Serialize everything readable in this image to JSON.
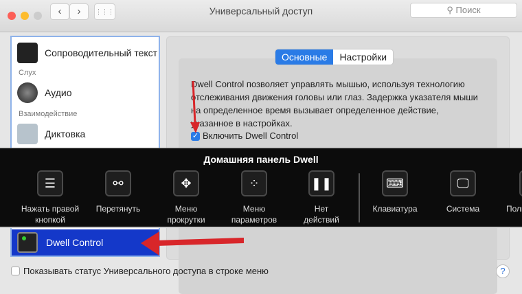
{
  "window": {
    "title": "Универсальный доступ",
    "search_placeholder": "Поиск",
    "back": "‹",
    "forward": "›",
    "grid": "⋮⋮⋮"
  },
  "sidebar": {
    "items": [
      {
        "type": "item",
        "label": "Сопроводительный текст"
      },
      {
        "type": "header",
        "label": "Слух"
      },
      {
        "type": "item",
        "label": "Аудио"
      },
      {
        "type": "header",
        "label": "Взаимодействие"
      },
      {
        "type": "item",
        "label": "Диктовка"
      }
    ],
    "selected": "Dwell Control"
  },
  "tabs": [
    {
      "label": "Основные",
      "active": true
    },
    {
      "label": "Настройки",
      "active": false
    }
  ],
  "main": {
    "description": "Dwell Control позволяет управлять мышью, используя технологию отслеживания движения головы или глаз. Задержка указателя мыши на определенное время вызывает определенное действие, указанное в настройках.",
    "enable_label": "Включить Dwell Control",
    "enable_checked": true
  },
  "overlay": {
    "title": "Домашняя панель Dwell",
    "items": [
      {
        "label1": "Нажать правой",
        "label2": "кнопкой",
        "icon": "☰"
      },
      {
        "label1": "Перетянуть",
        "label2": "",
        "icon": "⚯"
      },
      {
        "label1": "Меню",
        "label2": "прокрутки",
        "icon": "✥"
      },
      {
        "label1": "Меню",
        "label2": "параметров",
        "icon": "⁘"
      },
      {
        "label1": "Нет",
        "label2": "действий",
        "icon": "❚❚"
      },
      {
        "label1": "Клавиатура",
        "label2": "",
        "icon": "⌨"
      },
      {
        "label1": "Система",
        "label2": "",
        "icon": "🖵"
      },
      {
        "label1": "Поль",
        "label2": "",
        "icon": ""
      }
    ]
  },
  "bottom": {
    "status_label": "Показывать статус Универсального доступа в строке меню",
    "help": "?"
  },
  "colors": {
    "accent": "#2a7be6",
    "selection": "#1438c9",
    "arrow": "#d8262a"
  }
}
